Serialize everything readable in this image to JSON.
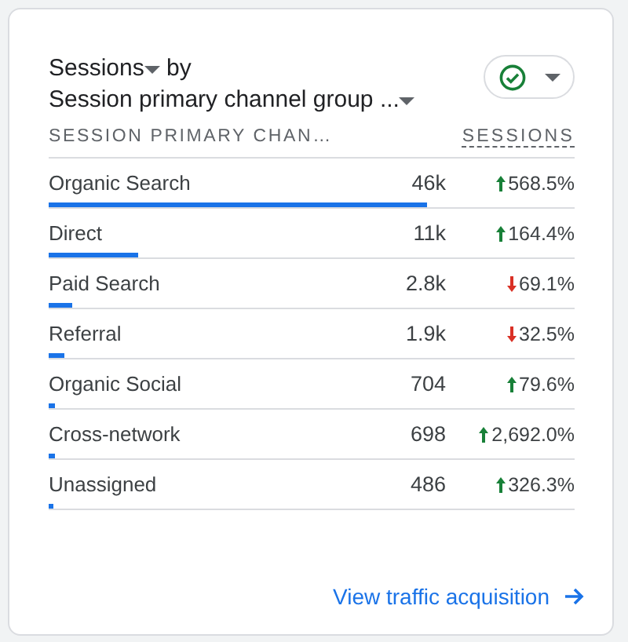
{
  "card": {
    "title_metric": "Sessions",
    "title_by": "by",
    "title_dimension": "Session primary channel group ...",
    "status_ok": true,
    "columns": [
      "SESSION PRIMARY CHAN…",
      "SESSIONS"
    ],
    "rows": [
      {
        "name": "Organic Search",
        "value": "46k",
        "change": "568.5%",
        "kind": "up",
        "level": 0.72
      },
      {
        "name": "Direct",
        "value": "11k",
        "change": "164.4%",
        "kind": "up",
        "level": 0.17
      },
      {
        "name": "Paid Search",
        "value": "2.8k",
        "change": "69.1%",
        "kind": "down",
        "level": 0.045
      },
      {
        "name": "Referral",
        "value": "1.9k",
        "change": "32.5%",
        "kind": "down",
        "level": 0.03
      },
      {
        "name": "Organic Social",
        "value": "704",
        "change": "79.6%",
        "kind": "up",
        "level": 0.012
      },
      {
        "name": "Cross-network",
        "value": "698",
        "change": "2,692.0%",
        "kind": "up",
        "level": 0.011
      },
      {
        "name": "Unassigned",
        "value": "486",
        "change": "326.3%",
        "kind": "up",
        "level": 0.008
      }
    ],
    "link": "View traffic acquisition"
  }
}
